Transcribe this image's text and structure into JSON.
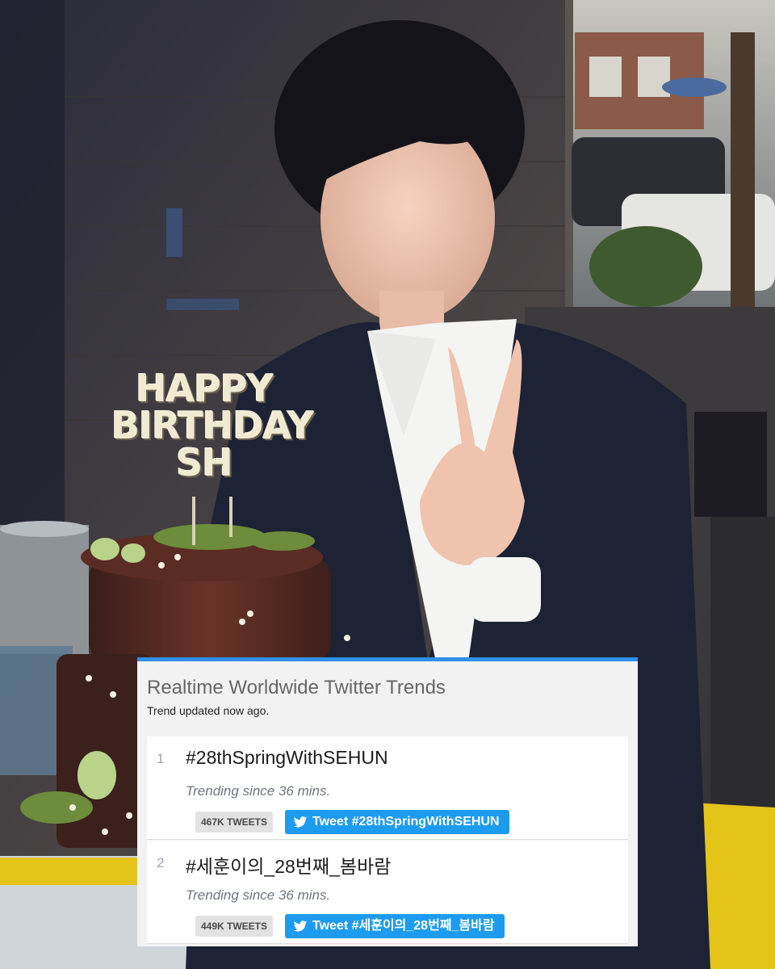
{
  "photo": {
    "cake_topper_lines": [
      "HAPPY",
      "BIRTHDAY",
      "SH"
    ]
  },
  "widget": {
    "title": "Realtime Worldwide Twitter Trends",
    "updated": "Trend updated now ago.",
    "accent_color": "#2f8fe9",
    "button_color": "#1d9bf0",
    "trends": [
      {
        "rank": "1",
        "hashtag": "#28thSpringWithSEHUN",
        "since": "Trending since 36 mins.",
        "count": "467K TWEETS",
        "button_label": "Tweet #28thSpringWithSEHUN",
        "icon": "twitter-bird-icon"
      },
      {
        "rank": "2",
        "hashtag": "#세훈이의_28번째_봄바람",
        "since": "Trending since 36 mins.",
        "count": "449K TWEETS",
        "button_label": "Tweet #세훈이의_28번째_봄바람",
        "icon": "twitter-bird-icon"
      }
    ]
  }
}
